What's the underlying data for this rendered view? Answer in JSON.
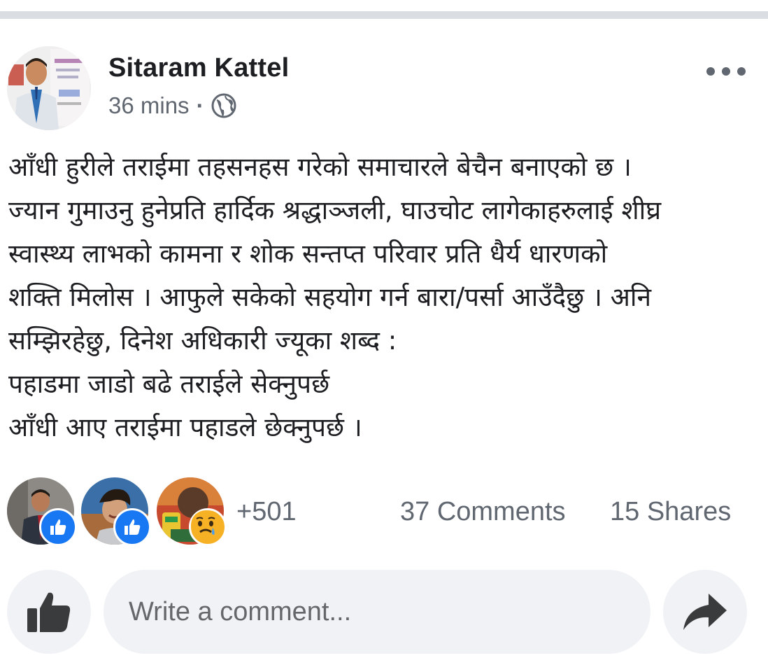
{
  "post": {
    "author": "Sitaram Kattel",
    "time": "36 mins",
    "separator": "·",
    "privacy_icon": "globe-icon",
    "menu_icon": "more-options-icon",
    "lines": [
      "आँधी हुरीले तराईमा तहसनहस गरेको समाचारले बेचैन बनाएको छ ।",
      "ज्यान गुमाउनु हुनेप्रति हार्दिक श्रद्धाञ्जली, घाउचोट लागेकाहरुलाई शीघ्र",
      "स्वास्थ्य लाभको कामना र शोक सन्तप्त परिवार प्रति धैर्य धारणको",
      "शक्ति मिलोस । आफुले सकेको सहयोग गर्न बारा/पर्सा आउँदैछु । अनि",
      "सम्झिरहेछु, दिनेश अधिकारी ज्यूका शब्द :",
      "पहाडमा जाडो बढे तराईले सेक्नुपर्छ",
      "आँधी आए तराईमा पहाडले छेक्नुपर्छ ।"
    ]
  },
  "reactions": {
    "count": "+501",
    "comments": "37 Comments",
    "shares": "15 Shares",
    "icons": [
      "like-icon",
      "like-icon",
      "sad-icon"
    ]
  },
  "actions": {
    "comment_placeholder": "Write a comment...",
    "like_icon": "thumbs-up-icon",
    "share_icon": "share-arrow-icon"
  },
  "colors": {
    "divider": "#dadde1",
    "secondary_text": "#616770",
    "like_blue": "#1877f2",
    "sad_yellow": "#f7b125",
    "button_bg": "#f0f2f5"
  }
}
